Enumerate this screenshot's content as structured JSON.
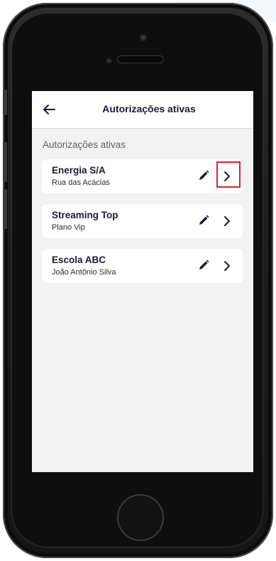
{
  "header": {
    "title": "Autorizações ativas",
    "back_icon": "arrow-left-icon"
  },
  "section": {
    "title": "Autorizações ativas"
  },
  "authorizations": [
    {
      "title": "Energia S/A",
      "subtitle": "Rua das Acácias",
      "edit_icon": "pencil-icon",
      "open_icon": "chevron-right-icon",
      "highlighted": true
    },
    {
      "title": "Streaming Top",
      "subtitle": "Plano Vip",
      "edit_icon": "pencil-icon",
      "open_icon": "chevron-right-icon",
      "highlighted": false
    },
    {
      "title": "Escola ABC",
      "subtitle": "João Antônio Silva",
      "edit_icon": "pencil-icon",
      "open_icon": "chevron-right-icon",
      "highlighted": false
    }
  ],
  "colors": {
    "title_text": "#1b1b3a",
    "screen_background": "#f2f2f2",
    "card_background": "#ffffff",
    "highlight": "#e0202b",
    "device_frame": "#1c1c1c"
  }
}
